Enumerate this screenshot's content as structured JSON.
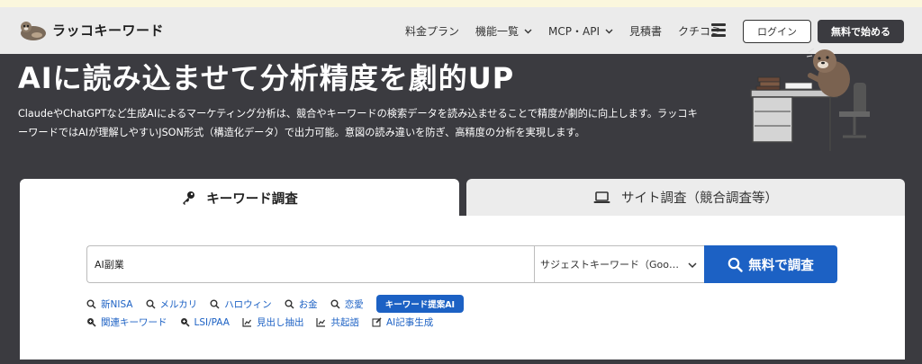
{
  "header": {
    "logo_text": "ラッコキーワード",
    "nav": [
      {
        "label": "料金プラン"
      },
      {
        "label": "機能一覧"
      },
      {
        "label": "MCP・API"
      },
      {
        "label": "見積書"
      },
      {
        "label": "クチコミ"
      }
    ],
    "login_label": "ログイン",
    "start_label": "無料で始める"
  },
  "hero": {
    "title": "AIに読み込ませて分析精度を劇的UP",
    "description": "ClaudeやChatGPTなど生成AIによるマーケティング分析は、競合やキーワードの検索データを読み込ませることで精度が劇的に向上します。ラッコキーワードではAIが理解しやすいJSON形式（構造化データ）で出力可能。意図の読み違いを防ぎ、高精度の分析を実現します。"
  },
  "tabs": [
    {
      "label": "キーワード調査",
      "icon": "key-icon",
      "active": true
    },
    {
      "label": "サイト調査（競合調査等）",
      "icon": "laptop-icon",
      "active": false
    }
  ],
  "search": {
    "value": "AI副業",
    "select_value": "サジェストキーワード（Google）",
    "button_label": "無料で調査"
  },
  "quick_links": {
    "row1": [
      {
        "label": "新NISA",
        "icon": "search-icon"
      },
      {
        "label": "メルカリ",
        "icon": "search-icon"
      },
      {
        "label": "ハロウィン",
        "icon": "search-icon"
      },
      {
        "label": "お金",
        "icon": "search-icon"
      },
      {
        "label": "恋愛",
        "icon": "search-icon"
      }
    ],
    "badge": "キーワード提案AI",
    "row2": [
      {
        "label": "関連キーワード",
        "icon": "search-plus-icon"
      },
      {
        "label": "LSI/PAA",
        "icon": "search-plus-icon"
      },
      {
        "label": "見出し抽出",
        "icon": "chart-line-icon"
      },
      {
        "label": "共起語",
        "icon": "chart-line-icon"
      },
      {
        "label": "AI記事生成",
        "icon": "edit-icon"
      }
    ]
  },
  "colors": {
    "header_bg": "#ebebeb",
    "hero_bg": "#3b3b40",
    "accent": "#1c61c4",
    "notice_strip": "#fbf7dd"
  }
}
